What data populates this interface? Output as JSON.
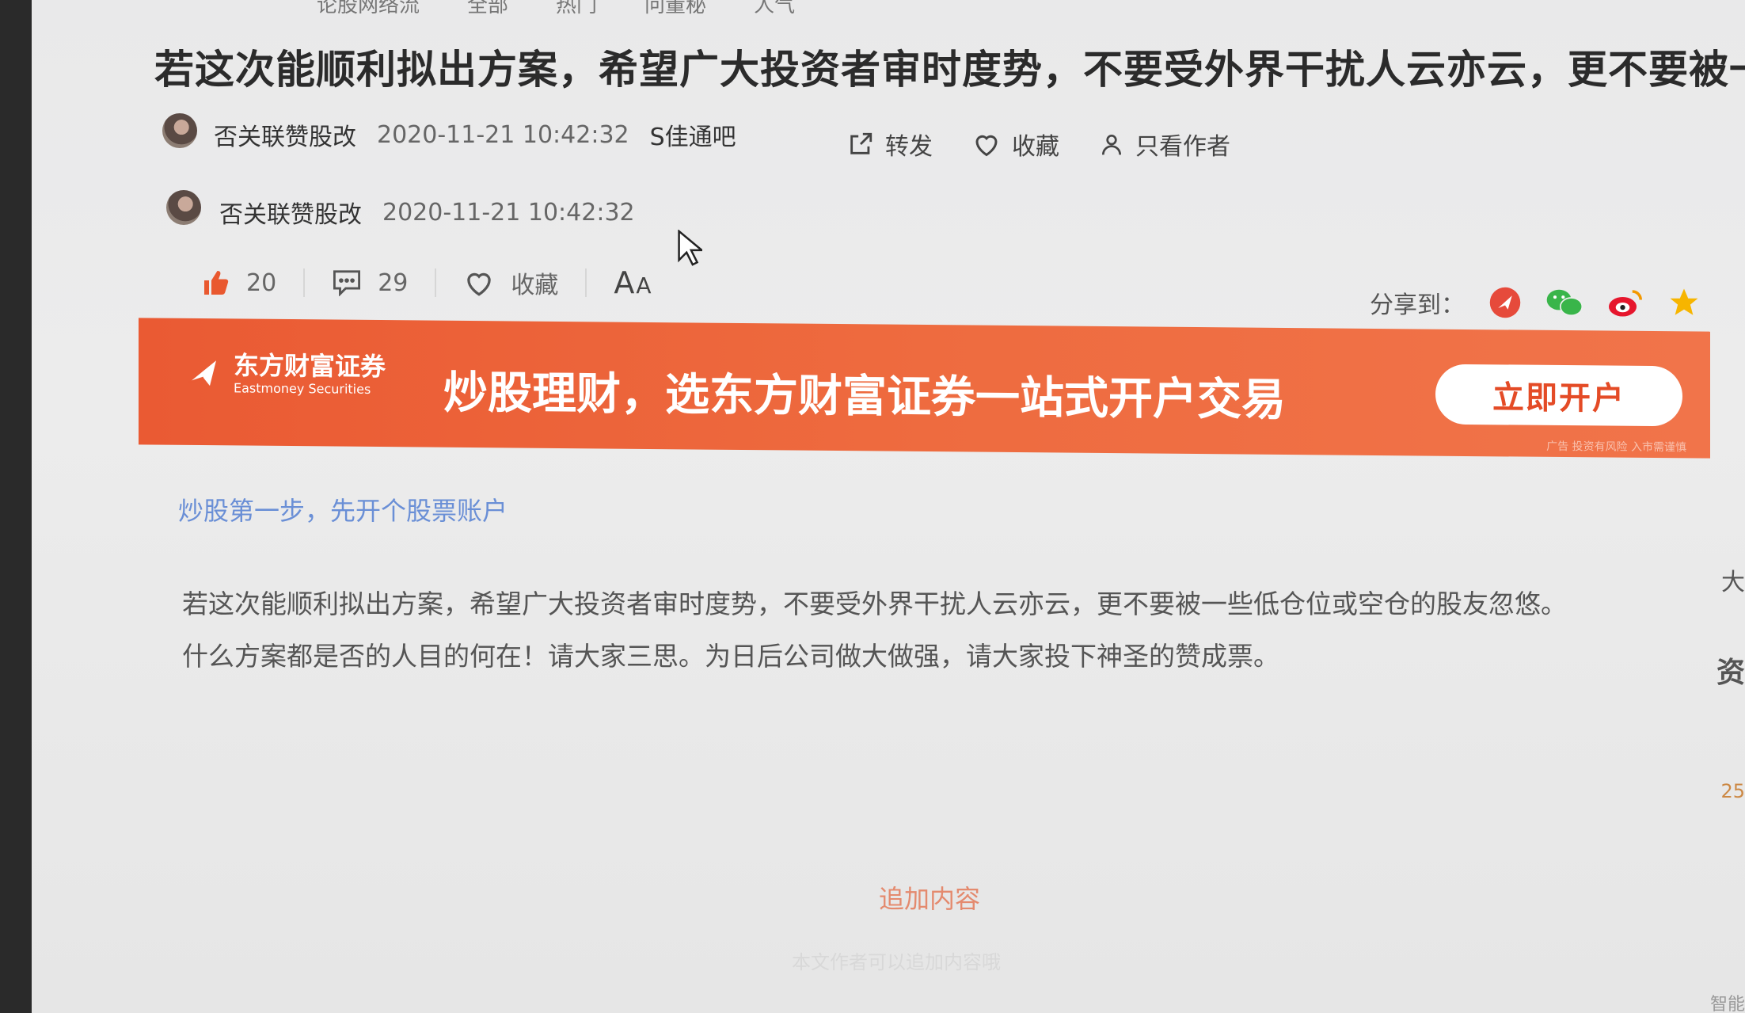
{
  "nav": {
    "items": [
      "论股网络流",
      "全部",
      "热门",
      "问董秘",
      "人气"
    ]
  },
  "post": {
    "title": "若这次能顺利拟出方案，希望广大投资者审时度势，不要受外界干扰人云亦云，更不要被一",
    "author": "否关联赞股改",
    "time": "2020-11-21 10:42:32",
    "bar": "S佳通吧",
    "actions": {
      "forward": "转发",
      "collect": "收藏",
      "author_only": "只看作者"
    },
    "reply_author": "否关联赞股改",
    "reply_time": "2020-11-21 10:42:32",
    "likes": "20",
    "comments": "29",
    "collect_label": "收藏",
    "font_size_big": "A",
    "font_size_small": "A",
    "share_label": "分享到：",
    "content_line1": "若这次能顺利拟出方案，希望广大投资者审时度势，不要受外界干扰人云亦云，更不要被一些低仓位或空仓的股友忽悠。",
    "content_line2": "什么方案都是否的人目的何在！请大家三思。为日后公司做大做强，请大家投下神圣的赞成票。",
    "append_label": "追加内容",
    "append_note": "本文作者可以追加内容哦"
  },
  "banner": {
    "logo_cn": "东方财富证券",
    "logo_en": "Eastmoney Securities",
    "slogan": "炒股理财，选东方财富证券一站式开户交易",
    "cta": "立即开户",
    "ad_tag": "广告 投资有风险 入市需谨慎"
  },
  "promo_link": "炒股第一步，先开个股票账户",
  "right_edge": {
    "frag1": "大",
    "frag2": "资",
    "frag3": "25",
    "frag4": "智能"
  },
  "colors": {
    "accent": "#e9582f",
    "link": "#6a8fd6",
    "like": "#e9582f"
  },
  "icons": [
    "thumbs-up-icon",
    "comment-icon",
    "heart-icon",
    "forward-icon",
    "user-icon",
    "weibo-icon",
    "wechat-icon",
    "star-icon"
  ]
}
